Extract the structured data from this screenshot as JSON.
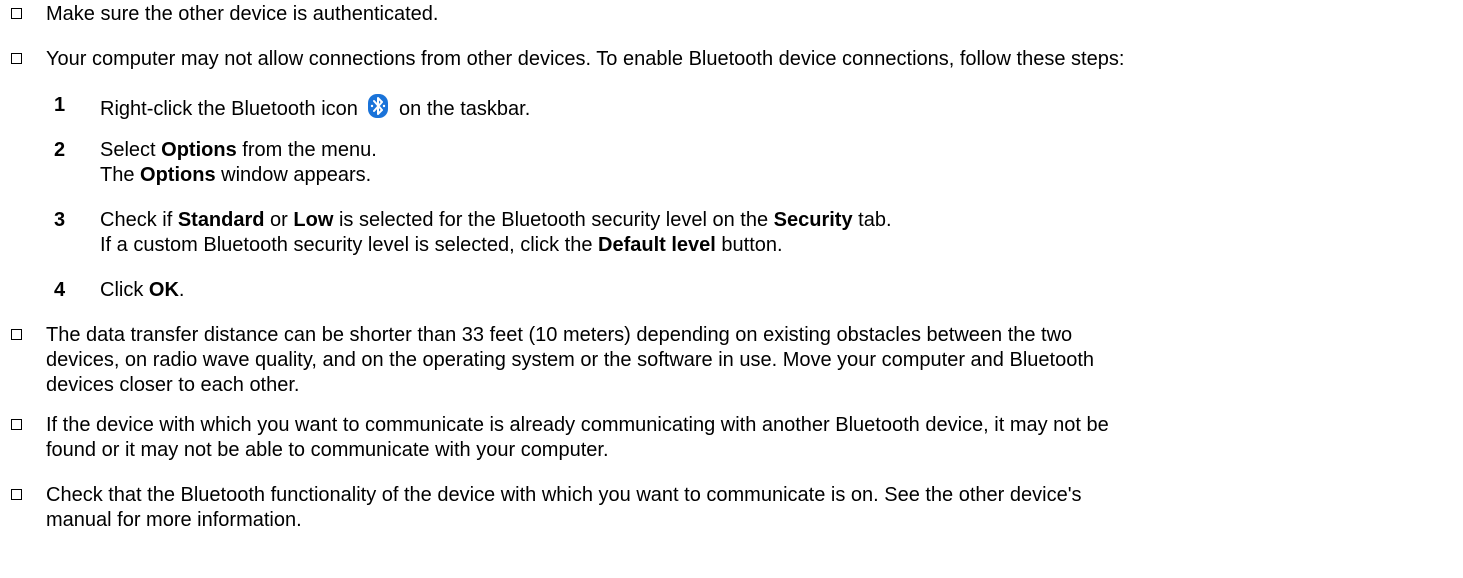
{
  "bullets": {
    "b1": "Make sure the other device is authenticated.",
    "b2": "Your computer may not allow connections from other devices. To enable Bluetooth device connections, follow these steps:",
    "b3": [
      "The data transfer distance can be shorter than 33 feet (10 meters) depending on existing obstacles between the two",
      "devices, on radio wave quality, and on the operating system or the software in use. Move your computer and Bluetooth",
      "devices closer to each other."
    ],
    "b4": [
      "If the device with which you want to communicate is already communicating with another Bluetooth device, it may not be",
      "found or it may not be able to communicate with your computer."
    ],
    "b5": [
      "Check that the Bluetooth functionality of the device with which you want to communicate is on. See the other device's",
      "manual for more information."
    ]
  },
  "steps": {
    "s1": {
      "number": "1",
      "before_icon": "Right-click the Bluetooth icon",
      "icon": "bluetooth-icon",
      "after_icon": "on the taskbar."
    },
    "s2": {
      "number": "2",
      "a1": "Select ",
      "a1_bold": "Options",
      "a2": " from the menu.",
      "b1": "The ",
      "b1_bold": "Options",
      "b2": " window appears."
    },
    "s3": {
      "number": "3",
      "a1": "Check if ",
      "a1_bold": "Standard",
      "a2": " or ",
      "a2_bold": "Low",
      "a3": " is selected for the Bluetooth security level on the ",
      "a3_bold": "Security",
      "a4": " tab.",
      "b1": "If a custom Bluetooth security level is selected, click the ",
      "b1_bold": "Default level",
      "b2": " button."
    },
    "s4": {
      "number": "4",
      "a1": "Click ",
      "a1_bold": "OK",
      "a2": "."
    }
  },
  "colors": {
    "text": "#000000",
    "bluetooth_icon_bg": "#1a73d9"
  }
}
